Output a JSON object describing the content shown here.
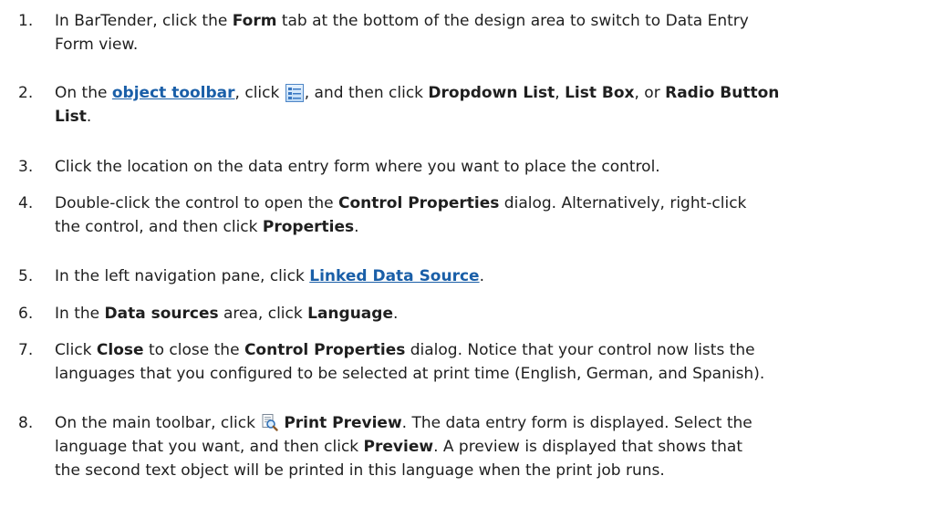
{
  "steps": [
    {
      "number": "1.",
      "line1": [
        "In BarTender, click the ",
        "Form",
        " tab at the bottom of the design area to switch to Data Entry"
      ],
      "line2": "Form view."
    },
    {
      "number": "2.",
      "line1": [
        "On the ",
        "object toolbar",
        ", click ",
        ", and then click ",
        "Dropdown List",
        ", ",
        "List Box",
        ", or ",
        "Radio Button"
      ],
      "line2": [
        "List",
        "."
      ],
      "icon": "list-control-icon"
    },
    {
      "number": "3.",
      "line1": "Click the location on the data entry form where you want to place the control."
    },
    {
      "number": "4.",
      "line1": [
        "Double-click the control to open the ",
        "Control Properties",
        " dialog. Alternatively, right-click"
      ],
      "line2": [
        "the control, and then click ",
        "Properties",
        "."
      ]
    },
    {
      "number": "5.",
      "line1": [
        "In the left navigation pane, click ",
        "Linked Data Source",
        "."
      ]
    },
    {
      "number": "6.",
      "line1": [
        "In the ",
        "Data sources",
        " area, click ",
        "Language",
        "."
      ]
    },
    {
      "number": "7.",
      "line1": [
        "Click ",
        "Close",
        " to close the ",
        "Control Properties",
        " dialog. Notice that your control now lists the"
      ],
      "line2": "languages that you configured to be selected at print time (English, German, and Spanish)."
    },
    {
      "number": "8.",
      "line1": [
        "On the main toolbar, click ",
        "Print Preview",
        ". The data entry form is displayed. Select the"
      ],
      "line2": [
        "language that you want, and then click ",
        "Preview",
        ". A preview is displayed that shows that"
      ],
      "line3": "the second text object will be printed in this language when the print job runs.",
      "icon": "print-preview-icon"
    }
  ],
  "colors": {
    "link": "#1a5fa8",
    "text": "#1f1f1f"
  }
}
